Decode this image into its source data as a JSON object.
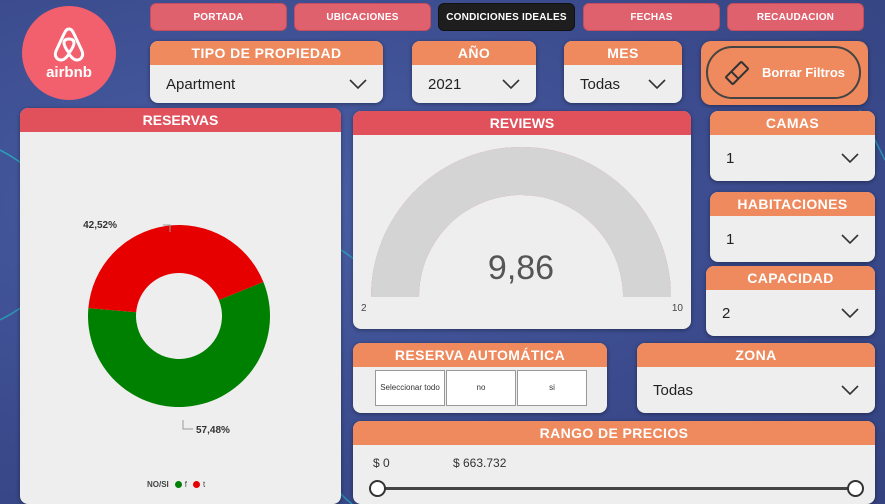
{
  "nav": {
    "items": [
      {
        "label": "PORTADA",
        "active": false
      },
      {
        "label": "UBICACIONES",
        "active": false
      },
      {
        "label": "CONDICIONES IDEALES",
        "active": true
      },
      {
        "label": "FECHAS",
        "active": false
      },
      {
        "label": "RECAUDACION",
        "active": false
      }
    ]
  },
  "logo": {
    "word": "airbnb"
  },
  "filters": {
    "tipo": {
      "label": "TIPO DE PROPIEDAD",
      "value": "Apartment"
    },
    "anio": {
      "label": "AÑO",
      "value": "2021"
    },
    "mes": {
      "label": "MES",
      "value": "Todas"
    },
    "camas": {
      "label": "CAMAS",
      "value": "1"
    },
    "habitaciones": {
      "label": "HABITACIONES",
      "value": "1"
    },
    "capacidad": {
      "label": "CAPACIDAD",
      "value": "2"
    },
    "zona": {
      "label": "ZONA",
      "value": "Todas"
    }
  },
  "clear_button": {
    "label": "Borrar Filtros"
  },
  "reservas": {
    "title": "RESERVAS",
    "slice_t_label": "42,52%",
    "slice_f_label": "57,48%",
    "legend_title": "NO/SI",
    "legend_f": "f",
    "legend_t": "t",
    "colors": {
      "f": "#008000",
      "t": "#e60000"
    }
  },
  "reviews": {
    "title": "REVIEWS",
    "value_label": "9,86",
    "min_label": "2",
    "max_label": "10",
    "fill_color": "#e0606e"
  },
  "reserva_auto": {
    "title": "RESERVA AUTOMÁTICA",
    "options": [
      "Seleccionar todo",
      "no",
      "si"
    ]
  },
  "precios": {
    "title": "RANGO DE PRECIOS",
    "min_label": "$ 0",
    "max_label": "$ 663.732"
  },
  "chart_data": [
    {
      "type": "pie",
      "title": "RESERVAS",
      "categories": [
        "f",
        "t"
      ],
      "values": [
        57.48,
        42.52
      ],
      "legend": "bottom"
    },
    {
      "type": "gauge",
      "title": "REVIEWS",
      "value": 9.86,
      "min": 2,
      "max": 10
    }
  ]
}
